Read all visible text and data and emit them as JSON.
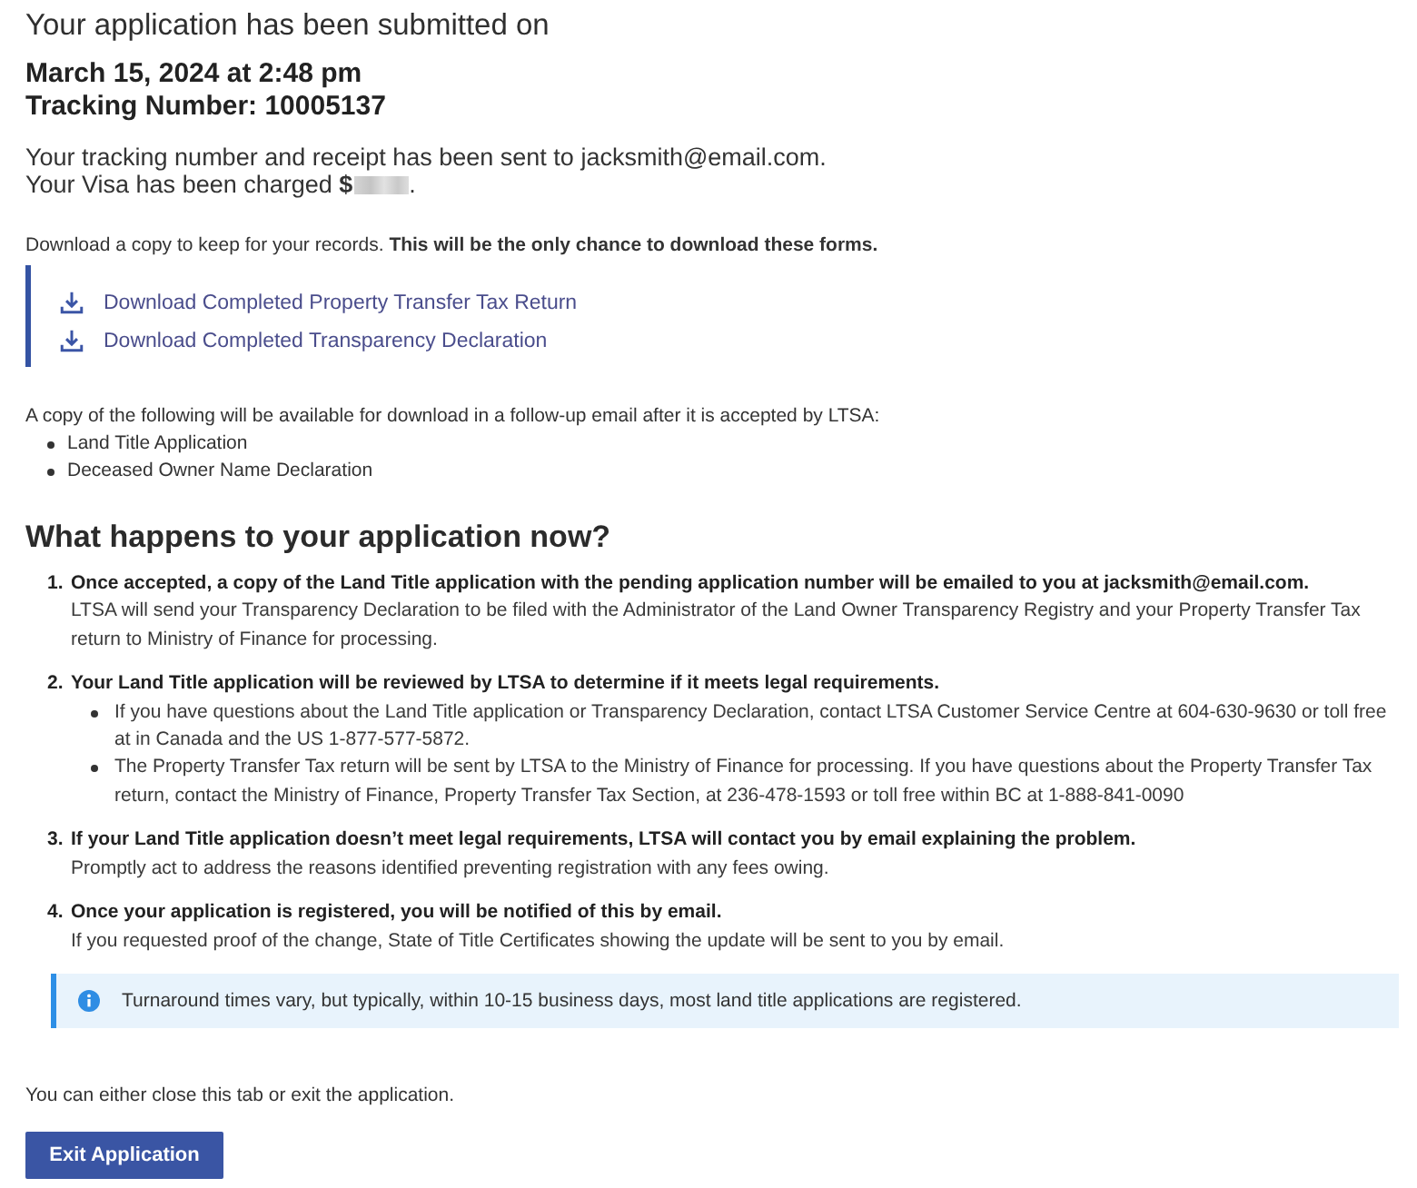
{
  "confirmation": {
    "heading": "Your application has been submitted on",
    "date_time": "March 15, 2024 at 2:48 pm",
    "tracking_number": "Tracking Number: 10005137",
    "receipt_notice": "Your tracking number and receipt has been sent to jacksmith@email.com.",
    "charge_text": "Your Visa has been charged **$**",
    "charge_amount_redacted": true,
    "charge_end": "."
  },
  "downloads": {
    "intro": "Download a copy to keep for your records. **This will be the only chance to download these forms.**",
    "links": [
      {
        "label": "Download Completed Property Transfer Tax Return"
      },
      {
        "label": "Download Completed Transparency Declaration"
      }
    ]
  },
  "follow_up": {
    "intro": "A copy of the following will be available for download in a follow-up email after it is accepted by LTSA:",
    "items": [
      "Land Title Application",
      "Deceased Owner Name Declaration"
    ]
  },
  "next_steps": {
    "title": "What happens to your application now?",
    "steps": [
      {
        "number": "1.",
        "title": "Once accepted, a copy of the Land Title application with the pending application number will be emailed to you at jacksmith@email.com.",
        "description": "LTSA will send your Transparency Declaration to be filed with the Administrator of the Land Owner Transparency Registry and your Property Transfer Tax return to Ministry of Finance for processing."
      },
      {
        "number": "2.",
        "title": "Your Land Title application will be reviewed by LTSA to determine if it meets legal requirements.",
        "bullets": [
          "If you have questions about the Land Title application or Transparency Declaration, contact LTSA Customer Service Centre at 604-630-9630 or toll free at in Canada and the US 1-877-577-5872.",
          "The Property Transfer Tax return will be sent by LTSA to the Ministry of Finance for processing. If you have questions about the Property Transfer Tax return, contact the Ministry of Finance, Property Transfer Tax Section, at 236-478-1593 or toll free within BC at 1-888-841-0090"
        ]
      },
      {
        "number": "3.",
        "title": "If your Land Title application doesn’t meet legal requirements, LTSA will contact you by email explaining the problem.",
        "description": "Promptly act to address the reasons identified preventing registration with any fees owing."
      },
      {
        "number": "4.",
        "title": "Once your application is registered, you will be notified of this by email.",
        "description": "If you requested proof of the change, State of Title Certificates showing the update will be sent to you by email."
      }
    ]
  },
  "notice": {
    "kind": "info",
    "text": "Turnaround times vary, but typically, within 10-15 business days, most land title applications are registered."
  },
  "footer": {
    "text": "You can either close this tab or exit the application.",
    "button": "Exit Application"
  }
}
